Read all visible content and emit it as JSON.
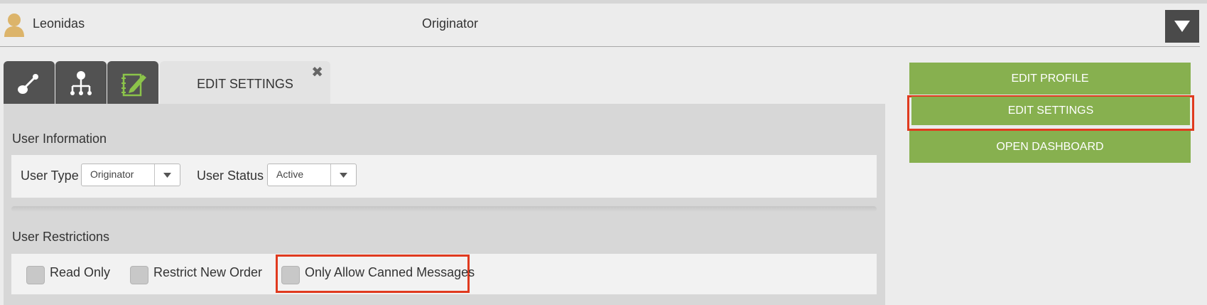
{
  "header": {
    "username": "Leonidas",
    "role": "Originator",
    "avatar_icon": "user-icon",
    "menu_icon": "caret-down-icon"
  },
  "tabs": {
    "icon_tabs": [
      "link-icon",
      "hierarchy-icon",
      "edit-notebook-icon"
    ],
    "active_label": "EDIT SETTINGS",
    "close_glyph": "✖"
  },
  "user_information": {
    "title": "User Information",
    "user_type_label": "User Type",
    "user_type_value": "Originator",
    "user_status_label": "User Status",
    "user_status_value": "Active"
  },
  "user_restrictions": {
    "title": "User Restrictions",
    "read_only": "Read Only",
    "restrict_new_order": "Restrict New Order",
    "only_allow_canned": "Only Allow Canned Messages"
  },
  "actions": {
    "edit_profile": "EDIT PROFILE",
    "edit_settings": "EDIT SETTINGS",
    "open_dashboard": "OPEN DASHBOARD"
  },
  "colors": {
    "accent_green": "#87b04f",
    "highlight_red": "#e03a1f",
    "tab_dark": "#525252"
  }
}
